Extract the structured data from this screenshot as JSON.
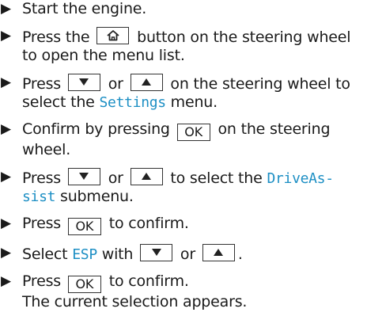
{
  "steps": [
    {
      "lines": [
        [
          {
            "t": "text",
            "v": "Start the engine."
          }
        ]
      ]
    },
    {
      "lines": [
        [
          {
            "t": "text",
            "v": "Press the "
          },
          {
            "t": "key",
            "icon": "home-icon"
          },
          {
            "t": "text",
            "v": " button on the steering wheel"
          }
        ],
        [
          {
            "t": "text",
            "v": "to open the menu list."
          }
        ]
      ]
    },
    {
      "lines": [
        [
          {
            "t": "text",
            "v": "Press "
          },
          {
            "t": "key",
            "icon": "down-triangle-icon"
          },
          {
            "t": "text",
            "v": " or "
          },
          {
            "t": "key",
            "icon": "up-triangle-icon"
          },
          {
            "t": "text",
            "v": " on the steering wheel to"
          }
        ],
        [
          {
            "t": "text",
            "v": "select the "
          },
          {
            "t": "hl",
            "v": "Settings"
          },
          {
            "t": "text",
            "v": " menu."
          }
        ]
      ]
    },
    {
      "lines": [
        [
          {
            "t": "text",
            "v": "Confirm by pressing "
          },
          {
            "t": "key",
            "label": "OK"
          },
          {
            "t": "text",
            "v": " on the steering"
          }
        ],
        [
          {
            "t": "text",
            "v": "wheel."
          }
        ]
      ]
    },
    {
      "lines": [
        [
          {
            "t": "text",
            "v": "Press "
          },
          {
            "t": "key",
            "icon": "down-triangle-icon"
          },
          {
            "t": "text",
            "v": " or "
          },
          {
            "t": "key",
            "icon": "up-triangle-icon"
          },
          {
            "t": "text",
            "v": " to select the "
          },
          {
            "t": "hl",
            "v": "DriveAs-"
          }
        ],
        [
          {
            "t": "hl",
            "v": "sist"
          },
          {
            "t": "text",
            "v": " submenu."
          }
        ]
      ]
    },
    {
      "lines": [
        [
          {
            "t": "text",
            "v": "Press "
          },
          {
            "t": "key",
            "label": "OK"
          },
          {
            "t": "text",
            "v": " to confirm."
          }
        ]
      ]
    },
    {
      "lines": [
        [
          {
            "t": "text",
            "v": "Select "
          },
          {
            "t": "hl",
            "v": "ESP"
          },
          {
            "t": "text",
            "v": " with "
          },
          {
            "t": "key",
            "icon": "down-triangle-icon"
          },
          {
            "t": "text",
            "v": " or "
          },
          {
            "t": "key",
            "icon": "up-triangle-icon"
          },
          {
            "t": "text",
            "v": "."
          }
        ]
      ]
    },
    {
      "lines": [
        [
          {
            "t": "text",
            "v": "Press "
          },
          {
            "t": "key",
            "label": "OK"
          },
          {
            "t": "text",
            "v": " to confirm."
          }
        ]
      ],
      "result": "The current selection appears."
    }
  ],
  "colors": {
    "text": "#1a1a1a",
    "highlight": "#1d8fc4",
    "key_border": "#333333"
  },
  "bullet_icon": "right-triangle-bullet-icon"
}
